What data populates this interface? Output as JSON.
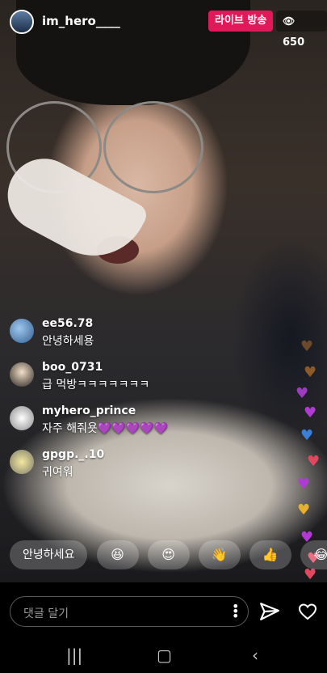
{
  "header": {
    "username": "im_hero____",
    "live_label": "라이브 방송",
    "viewer_count": "650",
    "eye_icon": "eye-icon"
  },
  "comments": [
    {
      "user": "ee56.78",
      "text": "안녕하세용"
    },
    {
      "user": "boo_0731",
      "text": "급 먹방ㅋㅋㅋㅋㅋㅋㅋ"
    },
    {
      "user": "myhero_prince",
      "text": "자주 해줘욧💜💜💜💜💜"
    },
    {
      "user": "gpgp._.10",
      "text": "귀여워"
    }
  ],
  "quick_replies": {
    "text_chip": "안녕하세요",
    "emojis": [
      "😆",
      "😍",
      "👋",
      "👍",
      "😂"
    ]
  },
  "composer": {
    "placeholder": "댓글 달기"
  },
  "floating_hearts": [
    {
      "color": "#6b4a2b"
    },
    {
      "color": "#8a5a2a"
    },
    {
      "color": "#9b3cc0"
    },
    {
      "color": "#b03ad2"
    },
    {
      "color": "#3a7fd6"
    },
    {
      "color": "#e04860"
    },
    {
      "color": "#b03ad2"
    },
    {
      "color": "#e8b030"
    },
    {
      "color": "#b03ad2"
    },
    {
      "color": "#e04860"
    },
    {
      "color": "#e04860"
    }
  ],
  "colors": {
    "live_badge": "#e0195a",
    "accent_text": "#ffffff"
  }
}
